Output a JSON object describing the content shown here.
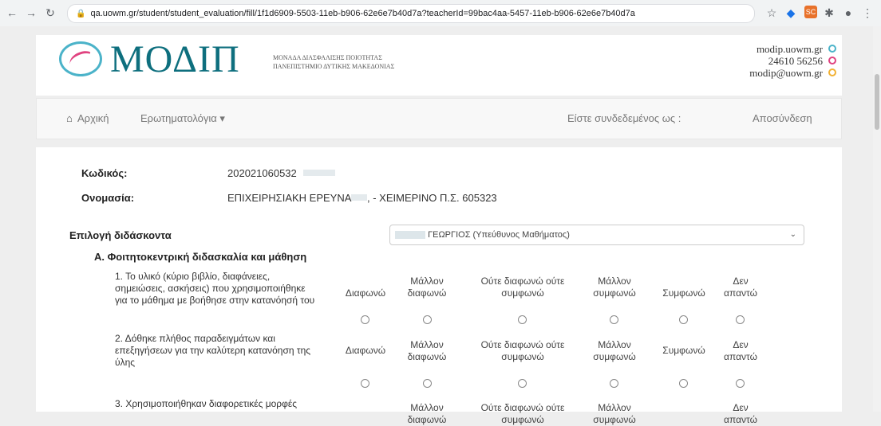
{
  "browser": {
    "url": "qa.uowm.gr/student/student_evaluation/fill/1f1d6909-5503-11eb-b906-62e6e7b40d7a?teacherId=99bac4aa-5457-11eb-b906-62e6e7b40d7a",
    "ext_label": "SC"
  },
  "header": {
    "logo_text": "ΜΟΔΙΠ",
    "subtitle_line1": "ΜΟΝΑΔΑ ΔΙΑΣΦΑΛΙΣΗΣ ΠΟΙΟΤΗΤΑΣ",
    "subtitle_line2": "ΠΑΝΕΠΙΣΤΗΜΙΟ ΔΥΤΙΚΗΣ ΜΑΚΕΔΟΝΙΑΣ",
    "website": "modip.uowm.gr",
    "phone": "24610 56256",
    "email": "modip@uowm.gr",
    "dot_colors": [
      "#4bb3c9",
      "#e04380",
      "#f2b134"
    ]
  },
  "navbar": {
    "home": "Αρχική",
    "questionnaires": "Ερωτηματολόγια ▾",
    "logged_in_as": "Είστε συνδεδεμένος ως :",
    "logout": "Αποσύνδεση"
  },
  "course": {
    "code_label": "Κωδικός:",
    "code_value": "202021060532",
    "name_label": "Ονομασία:",
    "name_value_part1": "ΕΠΙΧΕΙΡΗΣΙΑΚΗ ΕΡΕΥΝΑ",
    "name_value_part2": ", - ΧΕΙΜΕΡΙΝΟ Π.Σ. 605323"
  },
  "teacher": {
    "label": "Επιλογή διδάσκοντα",
    "selected": "ΓΕΩΡΓΙΟΣ (Υπεύθυνος Μαθήματος)"
  },
  "section": {
    "title": "Α. Φοιτητοκεντρική διδασκαλία και μάθηση"
  },
  "options": [
    "Διαφωνώ",
    "Μάλλον διαφωνώ",
    "Ούτε διαφωνώ ούτε συμφωνώ",
    "Μάλλον συμφωνώ",
    "Συμφωνώ",
    "Δεν απαντώ"
  ],
  "questions": [
    "1. Το υλικό (κύριο βιβλίο, διαφάνειες, σημειώσεις, ασκήσεις) που χρησιμοποιήθηκε για το μάθημα με βοήθησε στην κατανόησή του",
    "2. Δόθηκε πλήθος παραδειγμάτων και επεξηγήσεων για την καλύτερη κατανόηση της ύλης",
    "3. Χρησιμοποιήθηκαν διαφορετικές μορφές"
  ]
}
